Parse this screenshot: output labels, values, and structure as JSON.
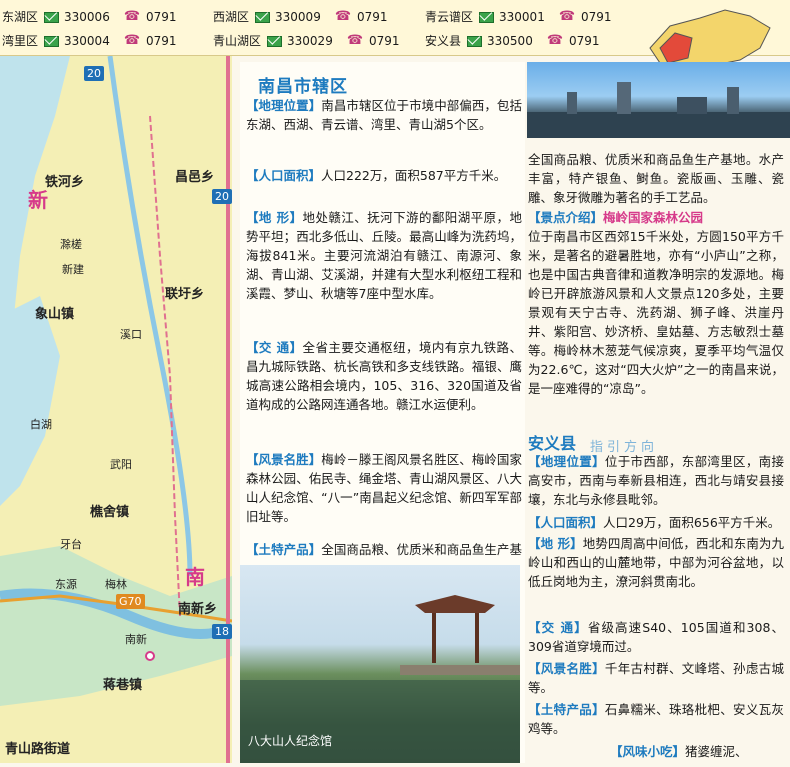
{
  "codes": [
    {
      "district": "东湖区",
      "postcode": "330006",
      "areacode": "0791"
    },
    {
      "district": "西湖区",
      "postcode": "330009",
      "areacode": "0791"
    },
    {
      "district": "青云谱区",
      "postcode": "330001",
      "areacode": "0791"
    },
    {
      "district": "湾里区",
      "postcode": "330004",
      "areacode": "0791"
    },
    {
      "district": "青山湖区",
      "postcode": "330029",
      "areacode": "0791"
    },
    {
      "district": "安义县",
      "postcode": "330500",
      "areacode": "0791"
    }
  ],
  "map": {
    "labels": [
      "新",
      "铁河乡",
      "昌邑乡",
      "象山镇",
      "联圩乡",
      "樵舍镇",
      "蒋巷镇",
      "南",
      "南新乡",
      "青山路街道",
      "20",
      "18",
      "G70"
    ],
    "small_labels": [
      "滁槎",
      "新建",
      "溪口",
      "白湖",
      "武阳",
      "南新",
      "牙台",
      "东源",
      "梅林"
    ]
  },
  "nanchang": {
    "title": "南昌市辖区",
    "sections": [
      {
        "tag": "【地理位置】",
        "text": "南昌市辖区位于市境中部偏西，包括东湖、西湖、青云谱、湾里、青山湖5个区。"
      },
      {
        "tag": "【人口面积】",
        "text": "人口222万，面积587平方千米。"
      },
      {
        "tag": "【地 形】",
        "text": "地处赣江、抚河下游的鄱阳湖平原，地势平坦；西北多低山、丘陵。最高山峰为洗药坞，海拔841米。主要河流湖泊有赣江、南源河、象湖、青山湖、艾溪湖，并建有大型水利枢纽工程和溪霞、梦山、秋塘等7座中型水库。"
      },
      {
        "tag": "【交 通】",
        "text": "全省主要交通枢纽，境内有京九铁路、昌九城际铁路、杭长高铁和多支线铁路。福银、鹰城高速公路相会境内，105、316、320国道及省道构成的公路网连通各地。赣江水运便利。"
      },
      {
        "tag": "【风景名胜】",
        "text": "梅岭－滕王阁风景名胜区、梅岭国家森林公园、佑民寺、绳金塔、青山湖风景区、八大山人纪念馆、“八一”南昌起义纪念馆、新四军军部旧址等。"
      },
      {
        "tag": "【土特产品】",
        "text": "全国商品粮、优质米和商品鱼生产基地。水产丰富，特产银鱼、鲥鱼。瓷版画、玉雕、瓷雕、象牙微雕为著名的手工艺品。"
      }
    ],
    "scenic": {
      "tag": "【景点介绍】",
      "name": "梅岭国家森林公园",
      "text": "位于南昌市区西郊15千米处，方圆150平方千米，是著名的避暑胜地，亦有“小庐山”之称，也是中国古典音律和道教净明宗的发源地。梅岭已开辟旅游风景和人文景点120多处，主要景观有天宁古寺、洗药湖、狮子峰、洪崖丹井、紫阳宫、妙济桥、皇姑墓、方志敏烈士墓等。梅岭林木葱茏气候凉爽，夏季平均气温仅为22.6℃，这对“四大火炉”之一的南昌来说，是一座难得的“凉岛”。"
    },
    "photo_caption": "八大山人纪念馆"
  },
  "anyi": {
    "title": "安义县",
    "guide": "指引方向",
    "sections": [
      {
        "tag": "【地理位置】",
        "text": "位于市西部，东部湾里区，南接高安市，西南与奉新县相连，西北与靖安县接壤，东北与永修县毗邻。"
      },
      {
        "tag": "【人口面积】",
        "text": "人口29万，面积656平方千米。"
      },
      {
        "tag": "【地 形】",
        "text": "地势四周高中间低，西北和东南为九岭山和西山的山麓地带，中部为河谷盆地，以低丘岗地为主，潦河斜贯南北。"
      },
      {
        "tag": "【交 通】",
        "text": "省级高速S40、105国道和308、309省道穿境而过。"
      },
      {
        "tag": "【风景名胜】",
        "text": "千年古村群、文峰塔、孙虑古城等。"
      },
      {
        "tag": "【土特产品】",
        "text": "石鼻糯米、珠珞枇杷、安义瓦灰鸡等。"
      },
      {
        "tag": "【风味小吃】",
        "text": "猪婆缠泥、"
      }
    ]
  },
  "colors": {
    "accent": "#1e7bbf",
    "map_pink": "#d63a8a",
    "postal_green": "#3aa24a"
  }
}
